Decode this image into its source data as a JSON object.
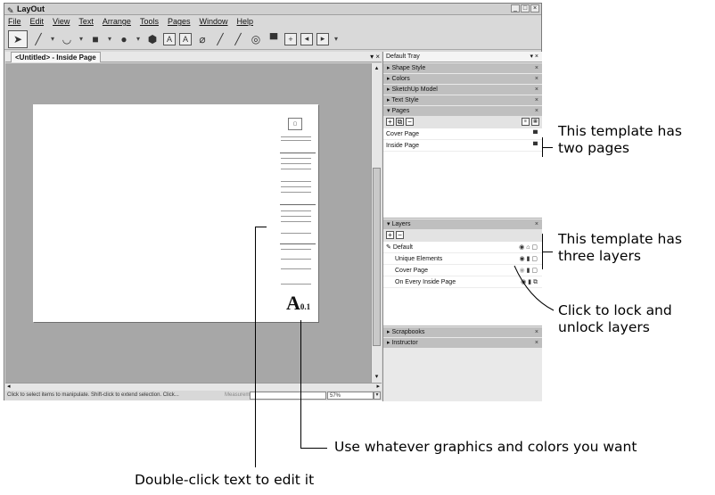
{
  "window": {
    "title": "LayOut",
    "controls": [
      "_",
      "□",
      "×"
    ]
  },
  "menu": [
    "File",
    "Edit",
    "View",
    "Text",
    "Arrange",
    "Tools",
    "Pages",
    "Window",
    "Help"
  ],
  "toolbar": {
    "tools": [
      "select-arrow",
      "pencil-line",
      "arc",
      "rectangle",
      "circle",
      "polygon",
      "text-box",
      "label",
      "eraser",
      "style-sampler",
      "style-paint",
      "split",
      "presentation",
      "add-page",
      "previous-page",
      "next-page"
    ]
  },
  "document": {
    "tab_label": "<Untitled> - Inside Page",
    "tab_controls": "▾ ×"
  },
  "page_preview": {
    "corner_letter": "A",
    "corner_sub": "0.1"
  },
  "statusbar": {
    "hint": "Click to select items to manipulate. Shift-click to extend selection. Click...",
    "measurements_label": "Measurements",
    "zoom": "57%"
  },
  "tray": {
    "title": "Default Tray",
    "title_controls": "▾ ×",
    "collapsed_panels": [
      "Shape Style",
      "Colors",
      "SketchUp Model",
      "Text Style"
    ],
    "pages_panel": {
      "title": "Pages",
      "pages": [
        "Cover Page",
        "Inside Page"
      ]
    },
    "layers_panel": {
      "title": "Layers",
      "layers": [
        {
          "name": "Default",
          "active": true
        },
        {
          "name": "Unique Elements",
          "active": false
        },
        {
          "name": "Cover Page",
          "active": false
        },
        {
          "name": "On Every Inside Page",
          "active": false
        }
      ]
    },
    "bottom_panels": [
      "Scrapbooks",
      "Instructor"
    ]
  },
  "callouts": {
    "pages": [
      "This template has",
      "two pages"
    ],
    "layers": [
      "This template has",
      "three layers"
    ],
    "lock": [
      "Click to lock and",
      "unlock layers"
    ],
    "graphics": "Use whatever graphics and colors you want",
    "edit_text": "Double-click text to edit it"
  }
}
